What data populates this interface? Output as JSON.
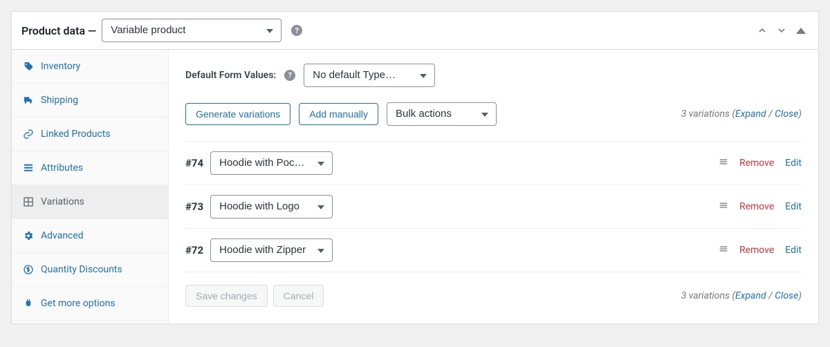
{
  "header": {
    "title": "Product data —",
    "product_type": "Variable product",
    "caret_up": "▴"
  },
  "sidebar": {
    "items": [
      {
        "key": "inventory",
        "label": "Inventory"
      },
      {
        "key": "shipping",
        "label": "Shipping"
      },
      {
        "key": "linked",
        "label": "Linked Products"
      },
      {
        "key": "attributes",
        "label": "Attributes"
      },
      {
        "key": "variations",
        "label": "Variations"
      },
      {
        "key": "advanced",
        "label": "Advanced"
      },
      {
        "key": "qty",
        "label": "Quantity Discounts"
      },
      {
        "key": "more",
        "label": "Get more options"
      }
    ],
    "active": "variations"
  },
  "main": {
    "default_label": "Default Form Values:",
    "default_select": "No default Type…",
    "generate_btn": "Generate variations",
    "add_btn": "Add manually",
    "bulk_select": "Bulk actions",
    "count_text": "3 variations",
    "expand": "Expand",
    "close": "Close",
    "save": "Save changes",
    "cancel": "Cancel",
    "remove_label": "Remove",
    "edit_label": "Edit",
    "variations": [
      {
        "id": "#74",
        "type": "Hoodie with Pocket"
      },
      {
        "id": "#73",
        "type": "Hoodie with Logo"
      },
      {
        "id": "#72",
        "type": "Hoodie with Zipper"
      }
    ]
  }
}
